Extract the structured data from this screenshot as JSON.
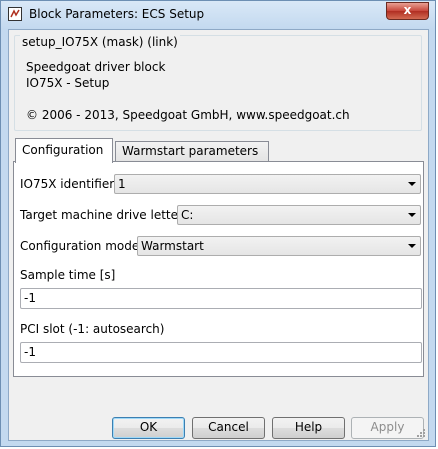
{
  "window": {
    "title": "Block Parameters: ECS Setup",
    "close_label": "x"
  },
  "description": {
    "group_title": "setup_IO75X (mask) (link)",
    "line1": "Speedgoat driver block",
    "line2": "IO75X - Setup",
    "copyright": "© 2006 - 2013, Speedgoat GmbH, www.speedgoat.ch"
  },
  "tabs": [
    {
      "label": "Configuration",
      "active": true
    },
    {
      "label": "Warmstart parameters",
      "active": false
    }
  ],
  "params": {
    "io75x_identifier": {
      "label": "IO75X identifier",
      "value": "1"
    },
    "drive_letter": {
      "label": "Target machine drive letter",
      "value": "C:"
    },
    "config_mode": {
      "label": "Configuration mode",
      "value": "Warmstart"
    },
    "sample_time": {
      "label": "Sample time [s]",
      "value": "-1"
    },
    "pci_slot": {
      "label": "PCI slot (-1: autosearch)",
      "value": "-1"
    }
  },
  "buttons": {
    "ok": "OK",
    "cancel": "Cancel",
    "help": "Help",
    "apply": "Apply"
  }
}
